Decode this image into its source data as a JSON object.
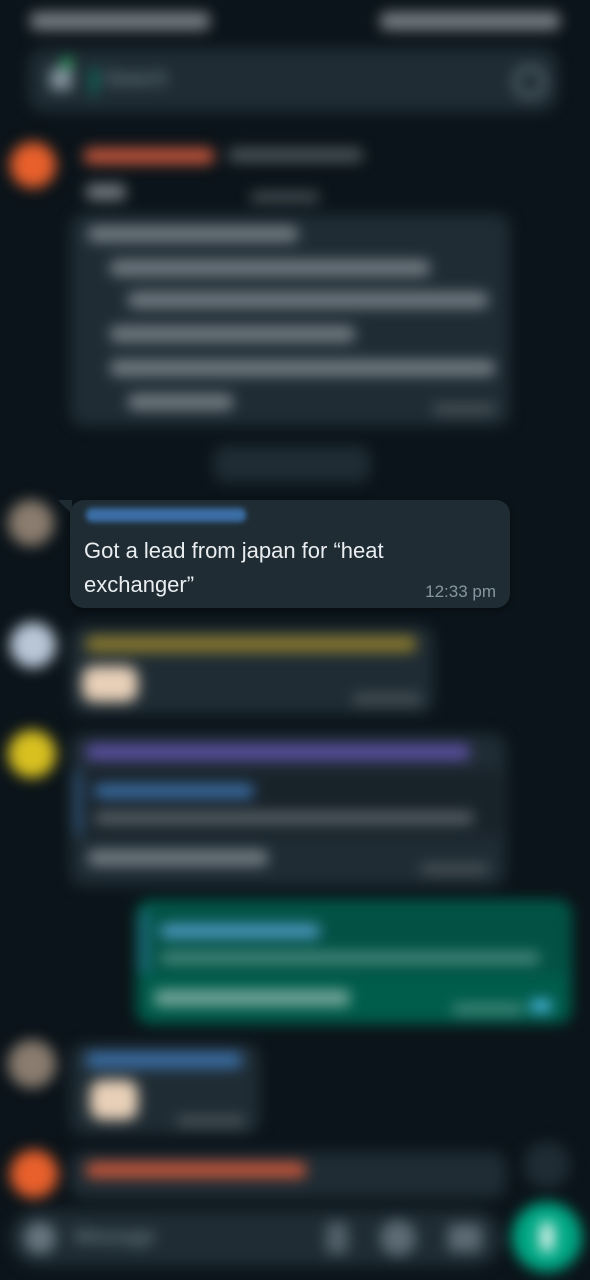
{
  "search": {
    "placeholder": "Search"
  },
  "messages": {
    "focused": {
      "text": "Got a lead from japan for “heat exchanger”",
      "time": "12:33 pm"
    }
  },
  "composer": {
    "placeholder": "Message"
  },
  "icons": {
    "back": "back-arrow-icon",
    "search": "search-icon",
    "attach": "paperclip-icon",
    "camera": "camera-icon",
    "emoji": "emoji-icon",
    "mic": "microphone-icon",
    "scroll_down": "chevron-down-icon"
  },
  "colors": {
    "background": "#0b141a",
    "incoming_bubble": "#1f2c34",
    "outgoing_bubble": "#005c4b",
    "accent_green": "#00a884",
    "time_text": "#8696a0"
  }
}
